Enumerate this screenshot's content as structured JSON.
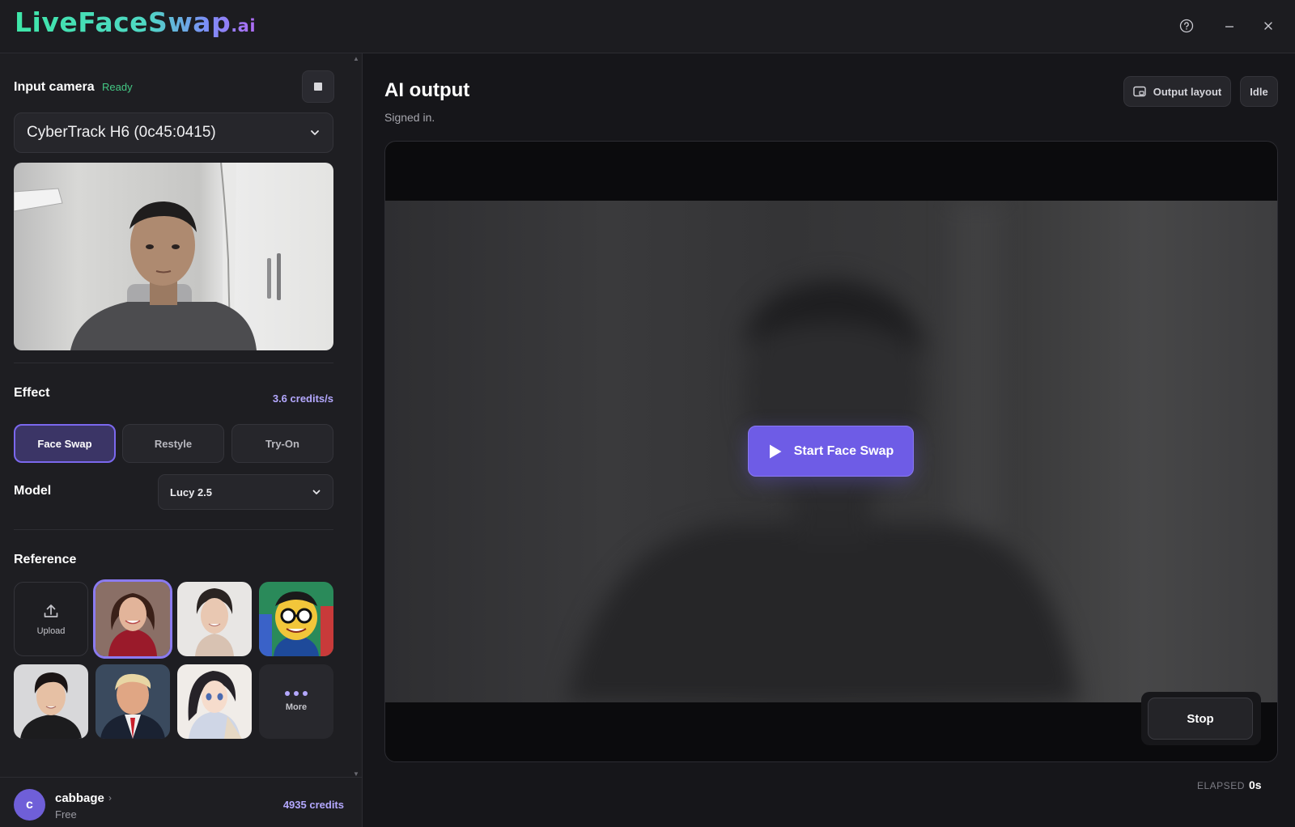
{
  "app": {
    "logo_main": "LiveFaceSwap",
    "logo_tld": ".ai"
  },
  "window_controls": {
    "help_icon": "help-circle",
    "minimize_icon": "minimize",
    "close_icon": "close"
  },
  "input_camera": {
    "title": "Input camera",
    "status": "Ready",
    "status_color": "#44c884",
    "selected_device": "CyberTrack H6 (0c45:0415)"
  },
  "effect": {
    "title": "Effect",
    "rate": "3.6 credits/s",
    "options": [
      "Face Swap",
      "Restyle",
      "Try-On"
    ],
    "selected": "Face Swap"
  },
  "model": {
    "title": "Model",
    "selected": "Lucy 2.5"
  },
  "reference": {
    "title": "Reference",
    "upload_label": "Upload",
    "more_label": "More",
    "selected_index": 1
  },
  "user": {
    "avatar_initial": "c",
    "name": "cabbage",
    "plan": "Free",
    "credits": "4935 credits"
  },
  "output": {
    "title": "AI output",
    "status_text": "Signed in.",
    "layout_button": "Output layout",
    "state_badge": "Idle",
    "start_button": "Start Face Swap",
    "stop_button": "Stop",
    "elapsed_label": "ELAPSED",
    "elapsed_value": "0s"
  },
  "colors": {
    "accent": "#6e5ce6",
    "credits_text": "#b4a8ff"
  }
}
